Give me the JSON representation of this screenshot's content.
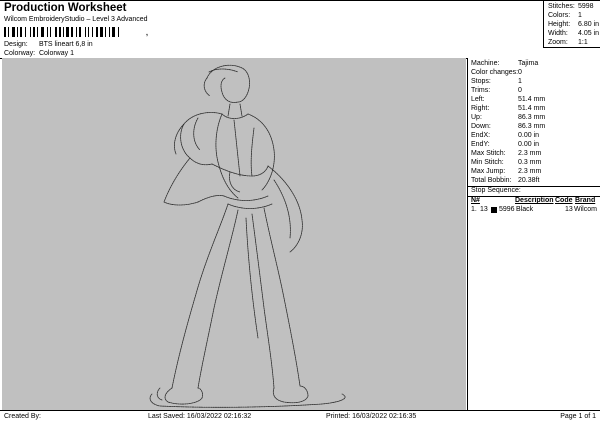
{
  "header": {
    "title": "Production Worksheet",
    "subtitle": "Wilcom EmbroideryStudio – Level 3 Advanced",
    "barcode_suffix": ",",
    "design_label": "Design:",
    "design_value": "BTS lineart 6,8 in",
    "colorway_label": "Colorway:",
    "colorway_value": "Colorway 1"
  },
  "top_stats": [
    {
      "label": "Stitches:",
      "value": "5998"
    },
    {
      "label": "Colors:",
      "value": "1"
    },
    {
      "label": "Height:",
      "value": "6.80 in"
    },
    {
      "label": "Width:",
      "value": "4.05 in"
    },
    {
      "label": "Zoom:",
      "value": "1:1"
    }
  ],
  "machine_info": [
    {
      "label": "Machine:",
      "value": "Tajima"
    },
    {
      "label": "Color changes:",
      "value": "0"
    },
    {
      "label": "Stops:",
      "value": "1"
    },
    {
      "label": "Trims:",
      "value": "0"
    },
    {
      "label": "Left:",
      "value": "51.4 mm"
    },
    {
      "label": "Right:",
      "value": "51.4 mm"
    },
    {
      "label": "Up:",
      "value": "86.3 mm"
    },
    {
      "label": "Down:",
      "value": "86.3 mm"
    },
    {
      "label": "EndX:",
      "value": "0.00 in"
    },
    {
      "label": "EndY:",
      "value": "0.00 in"
    },
    {
      "label": "Max Stitch:",
      "value": "2.3 mm"
    },
    {
      "label": "Min Stitch:",
      "value": "0.3 mm"
    },
    {
      "label": "Max Jump:",
      "value": "2.3 mm"
    },
    {
      "label": "Total Bobbin:",
      "value": "20.38ft"
    }
  ],
  "stop_sequence": {
    "title": "Stop Sequence:",
    "columns": [
      "N#",
      "Description",
      "Code",
      "Brand"
    ],
    "items": [
      {
        "index": "1.",
        "stop": "13",
        "stitches": "5996",
        "description": "Black",
        "code": "13",
        "brand": "Wilcom",
        "color": "#000000"
      }
    ]
  },
  "footer": {
    "created_by": "Created By:",
    "last_saved": "Last Saved: 16/03/2022 02:16:32",
    "printed": "Printed: 16/03/2022 02:16:35",
    "page": "Page 1 of 1"
  }
}
